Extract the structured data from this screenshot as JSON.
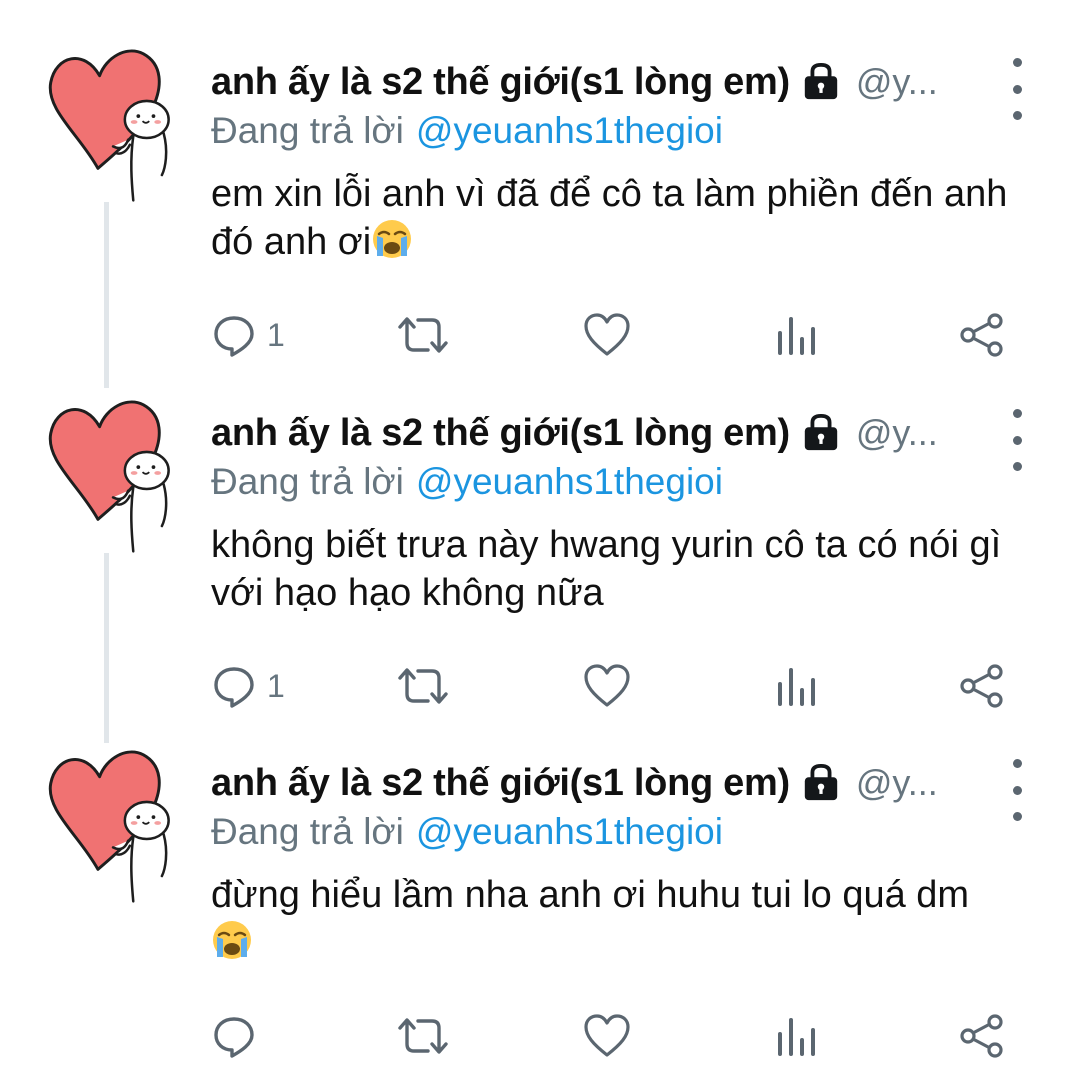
{
  "tweets": [
    {
      "name": "anh ấy là s2 thế giới(s1 lòng em)",
      "handle": "@y...",
      "replying_label": "Đang trả lời",
      "replying_to": "@yeuanhs1thegioi",
      "text": "em xin lỗi anh vì đã để cô ta làm phiền đến anh đó anh ơi",
      "emoji": "crying-face",
      "reply_count": "1"
    },
    {
      "name": "anh ấy là s2 thế giới(s1 lòng em)",
      "handle": "@y...",
      "replying_label": "Đang trả lời",
      "replying_to": "@yeuanhs1thegioi",
      "text": "không biết trưa này hwang yurin cô ta có nói gì với hạo hạo không nữa",
      "reply_count": "1"
    },
    {
      "name": "anh ấy là s2 thế giới(s1 lòng em)",
      "handle": "@y...",
      "replying_label": "Đang trả lời",
      "replying_to": "@yeuanhs1thegioi",
      "text": "đừng hiểu lầm nha anh ơi huhu tui lo quá dm",
      "emoji": "crying-face",
      "reply_count": ""
    }
  ],
  "colors": {
    "name": "#111111",
    "secondary": "#66757f",
    "mention": "#1b95e0",
    "avatar_heart": "#f07272",
    "thread_line": "#e1e6ea"
  }
}
